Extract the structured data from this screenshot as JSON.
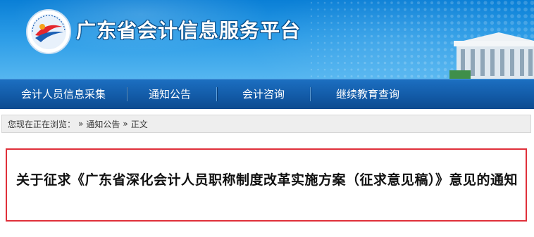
{
  "banner": {
    "logo_icon": "gd-accounting-logo-icon",
    "title": "广东省会计信息服务平台",
    "colors": {
      "top": "#0a7fd6",
      "bottom": "#55b6f0",
      "title_outline": "#0a4f8a"
    }
  },
  "nav": {
    "items": [
      {
        "label": "会计人员信息采集"
      },
      {
        "label": "通知公告"
      },
      {
        "label": "会计咨询"
      },
      {
        "label": "继续教育查询"
      }
    ],
    "color": "#1259a5"
  },
  "breadcrumb": {
    "prefix": "您现在正在浏览：",
    "separator": "»",
    "items": [
      {
        "label": "通知公告"
      },
      {
        "label": "正文"
      }
    ]
  },
  "article": {
    "title": "关于征求《广东省深化会计人员职称制度改革实施方案（征求意见稿）》意见的通知",
    "highlight_color": "#e0303a"
  }
}
